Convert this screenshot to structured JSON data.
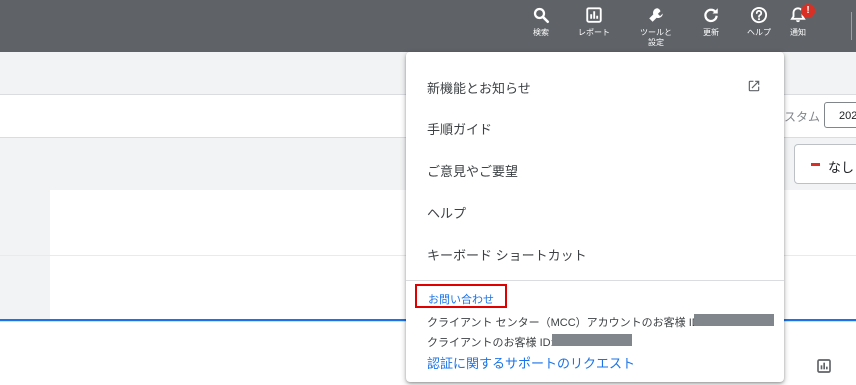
{
  "toolbar": {
    "items": [
      {
        "label": "検索",
        "icon": "search-icon"
      },
      {
        "label": "レポート",
        "icon": "report-icon"
      },
      {
        "label": "ツールと\n設定",
        "icon": "wrench-icon"
      },
      {
        "label": "更新",
        "icon": "refresh-icon"
      },
      {
        "label": "ヘルプ",
        "icon": "help-icon"
      },
      {
        "label": "通知",
        "icon": "bell-icon"
      }
    ],
    "notification_badge": "!"
  },
  "background": {
    "custom_label": "スタム",
    "date_value": "202",
    "none_button": "なし"
  },
  "help_menu": {
    "items": [
      {
        "label": "新機能とお知らせ",
        "external": true
      },
      {
        "label": "手順ガイド"
      },
      {
        "label": "ご意見やご要望"
      },
      {
        "label": "ヘルプ"
      },
      {
        "label": "キーボード ショートカット"
      }
    ],
    "contact_label": "お問い合わせ",
    "mcc_id_label": "クライアント センター（MCC）アカウントのお客様 ID:",
    "client_id_label": "クライアントのお客様 ID:",
    "verification_link": "認証に関するサポートのリクエスト"
  },
  "colors": {
    "topbar": "#5f6368",
    "accent": "#1a73e8",
    "alert": "#d93025",
    "highlight_box": "#e00000"
  }
}
